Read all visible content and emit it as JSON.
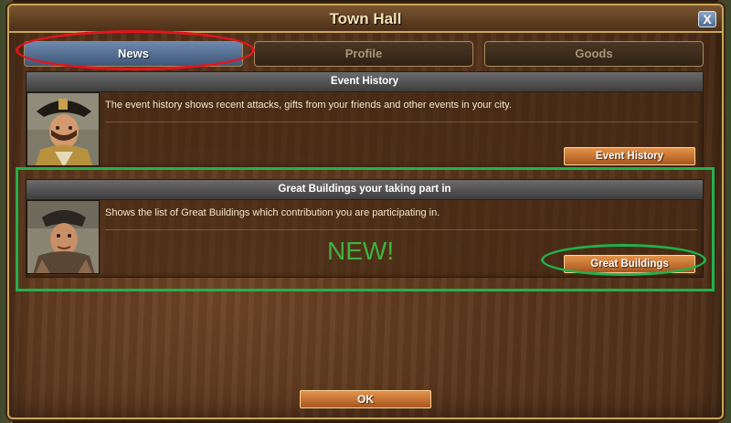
{
  "window": {
    "title": "Town Hall",
    "close_label": "X"
  },
  "tabs": [
    {
      "label": "News",
      "active": true
    },
    {
      "label": "Profile",
      "active": false
    },
    {
      "label": "Goods",
      "active": false
    }
  ],
  "sections": [
    {
      "header": "Event History",
      "description": "The event history shows recent attacks, gifts from your friends and other events in your city.",
      "button_label": "Event History",
      "portrait": "officer-portrait"
    },
    {
      "header": "Great Buildings your taking part in",
      "description": "Shows the list of Great Buildings which contribution you are participating in.",
      "button_label": "Great Buildings",
      "portrait": "scholar-portrait"
    }
  ],
  "annotation": {
    "new_label": "NEW!"
  },
  "footer": {
    "ok_label": "OK"
  },
  "colors": {
    "accent_gold": "#c9a55a",
    "tab_active": "#5a7398",
    "button_orange": "#d17b36",
    "annotation_red": "#e3161c",
    "annotation_green": "#22b14c"
  }
}
